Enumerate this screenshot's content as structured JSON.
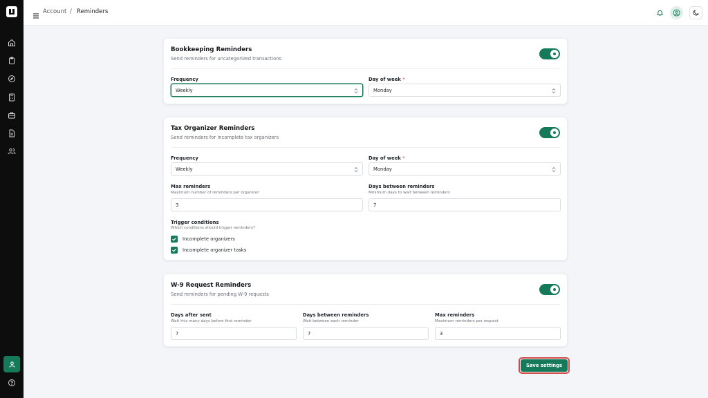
{
  "breadcrumb": {
    "parent": "Account",
    "separator": "/",
    "current": "Reminders"
  },
  "colors": {
    "accent": "#157a5a",
    "sidebar": "#0d0d0d",
    "highlight_border": "#d14848"
  },
  "sidebar": {
    "icons": [
      "home-icon",
      "clipboard-icon",
      "compass-icon",
      "calculator-icon",
      "briefcase-icon",
      "file-text-icon",
      "users-icon"
    ],
    "bottom": [
      "user-active-icon",
      "help-icon"
    ]
  },
  "bookkeeping": {
    "title": "Bookkeeping Reminders",
    "subtitle": "Send reminders for uncategorized transactions",
    "enabled": true,
    "frequency_label": "Frequency",
    "frequency_value": "Weekly",
    "day_label": "Day of week",
    "day_required": "*",
    "day_value": "Monday"
  },
  "tax": {
    "title": "Tax Organizer Reminders",
    "subtitle": "Send reminders for incomplete tax organizers",
    "enabled": true,
    "frequency_label": "Frequency",
    "frequency_value": "Weekly",
    "day_label": "Day of week",
    "day_required": "*",
    "day_value": "Monday",
    "max_label": "Max reminders",
    "max_hint": "Maximum number of reminders per organizer",
    "max_value": "3",
    "between_label": "Days between reminders",
    "between_hint": "Minimum days to wait between reminders",
    "between_value": "7",
    "trigger_label": "Trigger conditions",
    "trigger_hint": "Which conditions should trigger reminders?",
    "triggers": [
      {
        "label": "Incomplete organizers",
        "checked": true
      },
      {
        "label": "Incomplete organizer tasks",
        "checked": true
      }
    ]
  },
  "w9": {
    "title": "W-9 Request Reminders",
    "subtitle": "Send reminders for pending W-9 requests",
    "enabled": true,
    "after_label": "Days after sent",
    "after_hint": "Wait this many days before first reminder",
    "after_value": "7",
    "between_label": "Days between reminders",
    "between_hint": "Wait between each reminder",
    "between_value": "7",
    "max_label": "Max reminders",
    "max_hint": "Maximum reminders per request",
    "max_value": "3"
  },
  "save_label": "Save settings"
}
